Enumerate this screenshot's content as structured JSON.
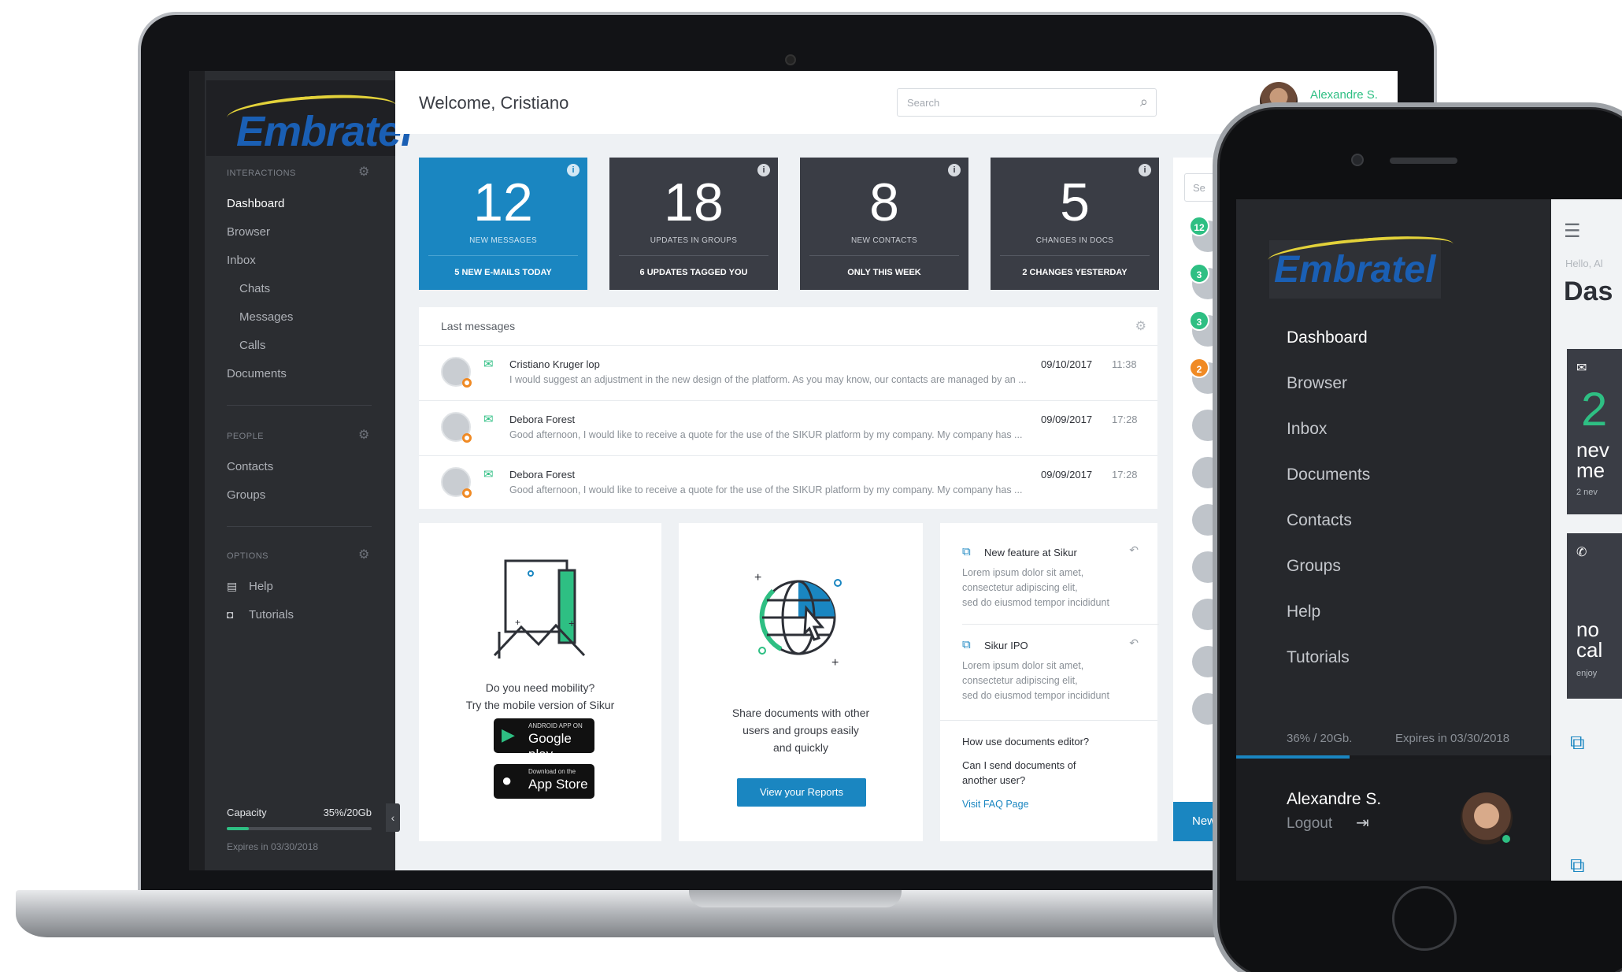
{
  "desktop": {
    "sidebar": {
      "logo": "Embratel",
      "interactions_heading": "INTERACTIONS",
      "items": [
        {
          "label": "Dashboard"
        },
        {
          "label": "Browser"
        },
        {
          "label": "Inbox"
        },
        {
          "label": "Chats"
        },
        {
          "label": "Messages"
        },
        {
          "label": "Calls"
        },
        {
          "label": "Documents"
        }
      ],
      "people_heading": "PEOPLE",
      "people_items": [
        {
          "label": "Contacts"
        },
        {
          "label": "Groups"
        }
      ],
      "options_heading": "OPTIONS",
      "options_items": [
        {
          "label": "Help",
          "icon": "book-icon"
        },
        {
          "label": "Tutorials",
          "icon": "video-icon"
        }
      ],
      "capacity_label": "Capacity",
      "capacity_value": "35%/20Gb",
      "capacity_fraction": 0.15,
      "expires": "Expires in 03/30/2018"
    },
    "header": {
      "welcome": "Welcome, Cristiano",
      "search_placeholder": "Search",
      "user_name": "Alexandre S."
    },
    "stats": [
      {
        "value": "12",
        "label": "NEW MESSAGES",
        "footer": "5 NEW E-MAILS TODAY",
        "color": "#1a86c1"
      },
      {
        "value": "18",
        "label": "UPDATES IN GROUPS",
        "footer": "6 UPDATES TAGGED YOU",
        "color": "#3a3d45"
      },
      {
        "value": "8",
        "label": "NEW CONTACTS",
        "footer": "ONLY THIS WEEK",
        "color": "#3a3d45"
      },
      {
        "value": "5",
        "label": "CHANGES IN DOCS",
        "footer": "2 CHANGES YESTERDAY",
        "color": "#3a3d45"
      }
    ],
    "last_messages": {
      "title": "Last messages",
      "rows": [
        {
          "from": "Cristiano Kruger lop",
          "preview": "I would suggest an adjustment in the new design of the platform. As you may know, our contacts are managed by an ...",
          "date": "09/10/2017",
          "time": "11:38"
        },
        {
          "from": "Debora Forest",
          "preview": "Good afternoon, I would like to receive a quote for the use of the SIKUR platform by my company. My company has ...",
          "date": "09/09/2017",
          "time": "17:28"
        },
        {
          "from": "Debora Forest",
          "preview": "Good afternoon, I would like to receive a quote for the use of the SIKUR platform by my company. My company has ...",
          "date": "09/09/2017",
          "time": "17:28"
        }
      ]
    },
    "mobility_card": {
      "line1": "Do you need mobility?",
      "line2": "Try the mobile version of Sikur",
      "google_small": "ANDROID APP ON",
      "google_big": "Google play",
      "apple_small": "Download on the",
      "apple_big": "App Store"
    },
    "share_card": {
      "line1": "Share documents with other",
      "line2": "users and groups easily",
      "line3": "and quickly",
      "button": "View your Reports"
    },
    "news_card": {
      "items": [
        {
          "title": "New feature at Sikur",
          "body": [
            "Lorem ipsum dolor sit amet,",
            "consectetur adipiscing elit,",
            "sed do eiusmod tempor incididunt"
          ]
        },
        {
          "title": "Sikur IPO",
          "body": [
            "Lorem ipsum dolor sit amet,",
            "consectetur adipiscing elit,",
            "sed do eiusmod tempor incididunt"
          ]
        }
      ],
      "faq1": "How use documents editor?",
      "faq2_line1": "Can I send documents of",
      "faq2_line2": "another user?",
      "faq_link": "Visit FAQ Page"
    },
    "chat_column": {
      "search_placeholder": "Se",
      "badges": [
        {
          "count": "12",
          "color": "#2ebf83"
        },
        {
          "count": "3",
          "color": "#2ebf83"
        },
        {
          "count": "3",
          "color": "#2ebf83"
        },
        {
          "count": "2",
          "color": "#f08a24"
        }
      ],
      "new_button": "New"
    }
  },
  "phone": {
    "logo": "Embratel",
    "menu": [
      {
        "label": "Dashboard"
      },
      {
        "label": "Browser"
      },
      {
        "label": "Inbox"
      },
      {
        "label": "Documents"
      },
      {
        "label": "Contacts"
      },
      {
        "label": "Groups"
      },
      {
        "label": "Help"
      },
      {
        "label": "Tutorials"
      }
    ],
    "capacity": "36% / 20Gb.",
    "capacity_fraction": 0.36,
    "expires": "Expires in 03/30/2018",
    "user_name": "Alexandre S.",
    "logout": "Logout",
    "peek": {
      "hello": "Hello, Al",
      "title": "Das",
      "card1_num": "2",
      "card1_line1": "nev",
      "card1_line2": "me",
      "card1_sub": "2 nev",
      "card2_line1": "no",
      "card2_line2": "cal",
      "card2_sub": "enjoy"
    }
  }
}
